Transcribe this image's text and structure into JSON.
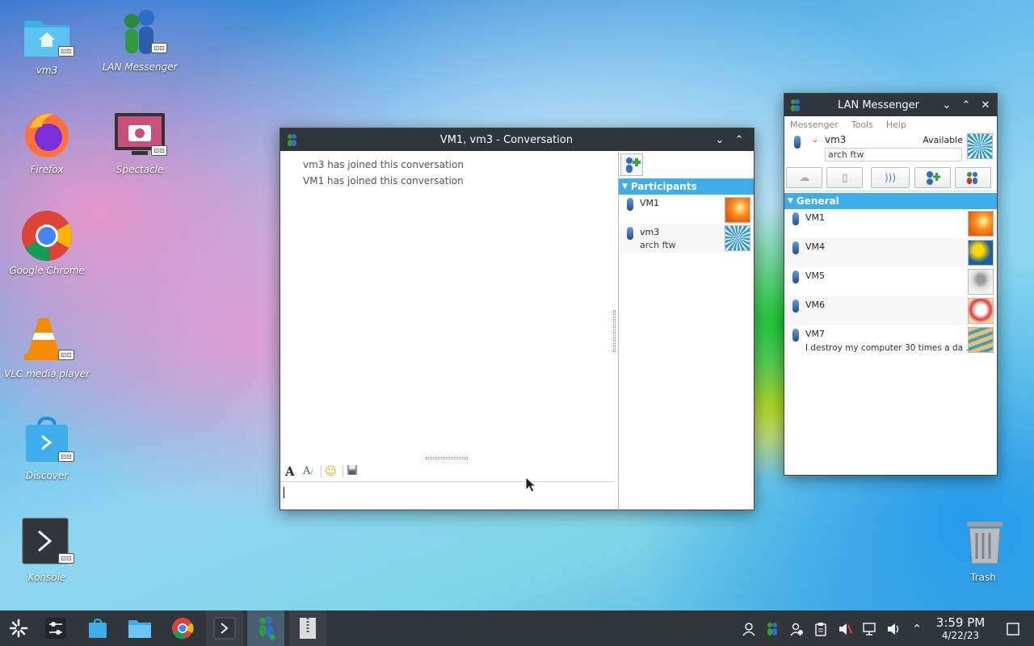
{
  "desktop": {
    "icons": [
      {
        "label": "vm3"
      },
      {
        "label": "LAN Messenger"
      },
      {
        "label": "Firefox"
      },
      {
        "label": "Spectacle"
      },
      {
        "label": "Google Chrome"
      },
      {
        "label": "VLC media player"
      },
      {
        "label": "Discover"
      },
      {
        "label": "Konsole"
      },
      {
        "label": "Trash"
      }
    ]
  },
  "conversation": {
    "title": "VM1, vm3 - Conversation",
    "messages": [
      "vm3 has joined this conversation",
      "VM1 has joined this conversation"
    ],
    "participants_header": "Participants",
    "participants": [
      {
        "name": "VM1",
        "status": ""
      },
      {
        "name": "vm3",
        "status": "arch ftw"
      }
    ],
    "input_value": ""
  },
  "messenger": {
    "title": "LAN Messenger",
    "menu": [
      "Messenger",
      "Tools",
      "Help"
    ],
    "username": "vm3",
    "status": "Available",
    "status_message": "arch ftw",
    "group": "General",
    "contacts": [
      {
        "name": "VM1",
        "note": ""
      },
      {
        "name": "VM4",
        "note": ""
      },
      {
        "name": "VM5",
        "note": ""
      },
      {
        "name": "VM6",
        "note": ""
      },
      {
        "name": "VM7",
        "note": "I destroy my computer 30 times a da ..."
      }
    ]
  },
  "taskbar": {
    "clock_time": "3:59 PM",
    "clock_date": "4/22/23"
  }
}
